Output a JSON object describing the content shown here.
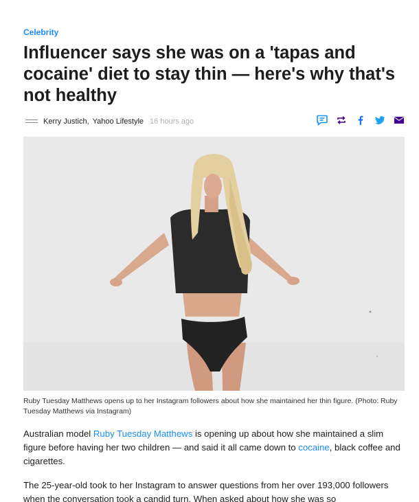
{
  "article": {
    "category": "Celebrity",
    "headline": "Influencer says she was on a 'tapas and cocaine' diet to stay thin — here's why that's not healthy",
    "byline": {
      "logo_icon": "yahoo-lifestyle-logo-icon",
      "author": "Kerry Justich,",
      "source": "Yahoo Lifestyle",
      "time": "16 hours ago"
    },
    "share_icons": [
      "comment-icon",
      "retweet-icon",
      "facebook-icon",
      "twitter-icon",
      "mail-icon"
    ],
    "caption": "Ruby Tuesday Matthews opens up to her Instagram followers about how she maintained her thin figure. (Photo: Ruby Tuesday Matthews via Instagram)",
    "p1": {
      "t1": "Australian model ",
      "link1": "Ruby Tuesday Matthews",
      "t2": " is opening up about how she maintained a slim figure before having her two children — and said it all came down to ",
      "link2": "cocaine",
      "t3": ", black coffee and cigarettes."
    },
    "p2": "The 25-year-old took to her Instagram to answer questions from her over 193,000 followers when the conversation took a candid turn. When asked about how she was so",
    "colors": {
      "accent": "#188fff",
      "twitter": "#1da1f2",
      "mail": "#400090",
      "text": "#1d1d1d",
      "muted": "#b0b0b0"
    }
  }
}
